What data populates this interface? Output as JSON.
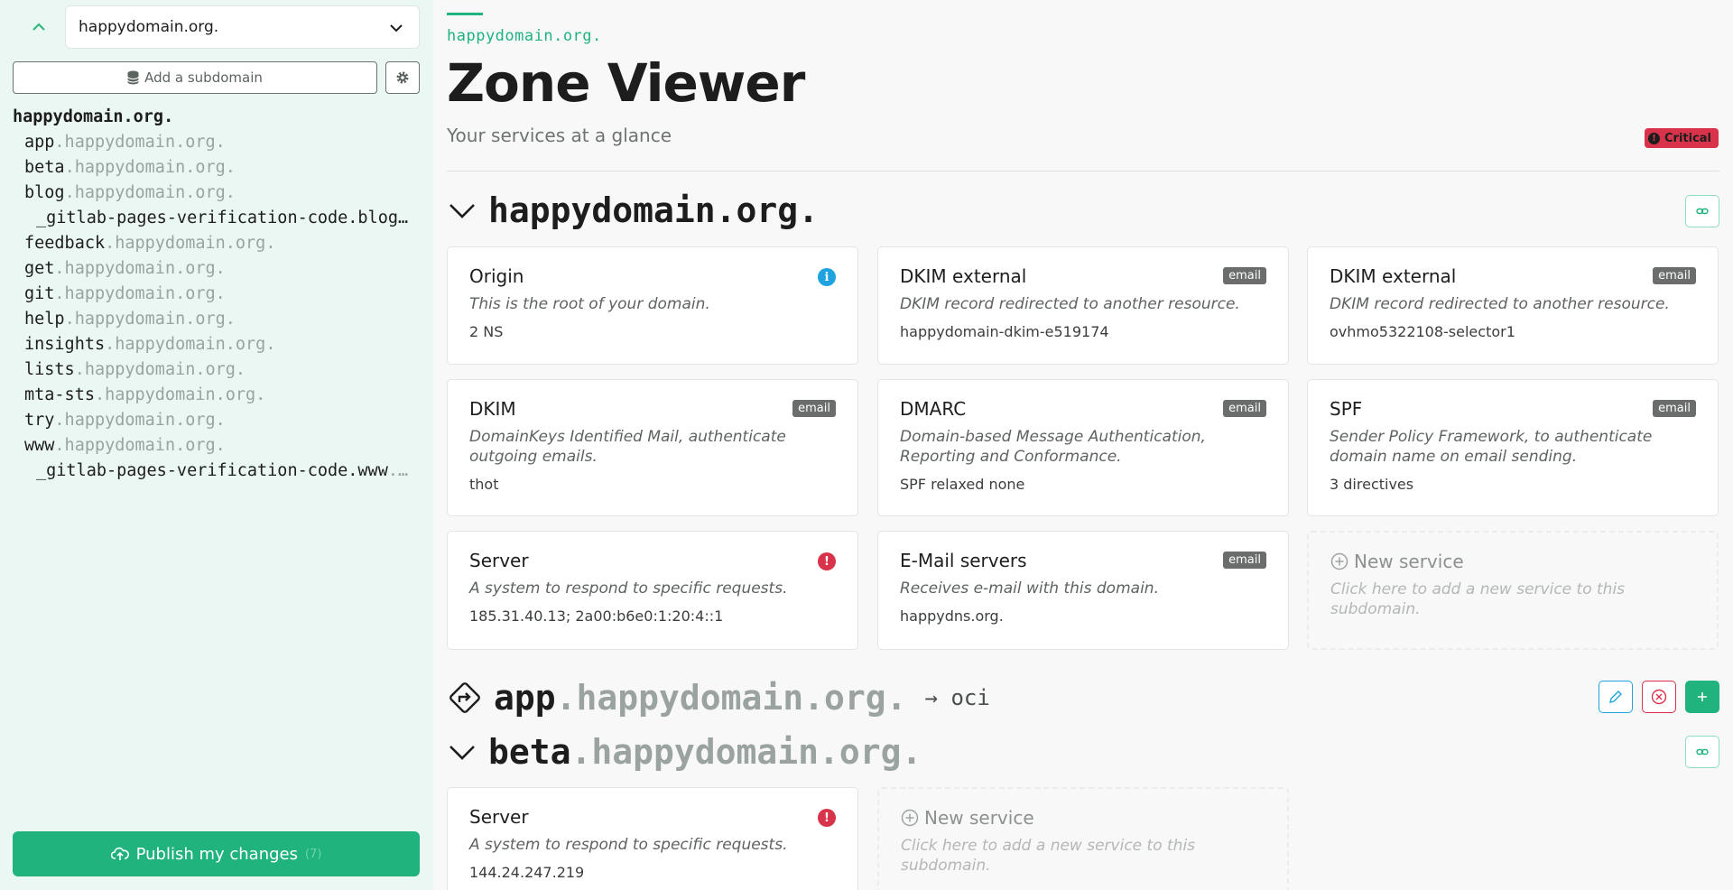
{
  "sidebar": {
    "domain_select": "happydomain.org.",
    "add_subdomain_label": "Add a subdomain",
    "tree": {
      "root": "happydomain.org.",
      "items": [
        {
          "name": "app",
          "suffix": ".happydomain.org.",
          "deep": false
        },
        {
          "name": "beta",
          "suffix": ".happydomain.org.",
          "deep": false
        },
        {
          "name": "blog",
          "suffix": ".happydomain.org.",
          "deep": false
        },
        {
          "name": "_gitlab-pages-verification-code.blog…",
          "suffix": "",
          "deep": true
        },
        {
          "name": "feedback",
          "suffix": ".happydomain.org.",
          "deep": false
        },
        {
          "name": "get",
          "suffix": ".happydomain.org.",
          "deep": false
        },
        {
          "name": "git",
          "suffix": ".happydomain.org.",
          "deep": false
        },
        {
          "name": "help",
          "suffix": ".happydomain.org.",
          "deep": false
        },
        {
          "name": "insights",
          "suffix": ".happydomain.org.",
          "deep": false
        },
        {
          "name": "lists",
          "suffix": ".happydomain.org.",
          "deep": false
        },
        {
          "name": "mta-sts",
          "suffix": ".happydomain.org.",
          "deep": false
        },
        {
          "name": "try",
          "suffix": ".happydomain.org.",
          "deep": false
        },
        {
          "name": "www",
          "suffix": ".happydomain.org.",
          "deep": false
        },
        {
          "name": "_gitlab-pages-verification-code.www",
          "suffix": ".…",
          "deep": true
        }
      ]
    },
    "publish_label": "Publish my changes",
    "publish_count": "(7)"
  },
  "main": {
    "breadcrumb": "happydomain.org.",
    "title": "Zone Viewer",
    "subtitle": "Your services at a glance",
    "critical_label": "Critical",
    "zones": {
      "root": {
        "name": "happydomain.org.",
        "cards": [
          {
            "title": "Origin",
            "desc": "This is the root of your domain.",
            "value": "2 NS"
          },
          {
            "title": "DKIM external",
            "badge": "email",
            "desc": "DKIM record redirected to another resource.",
            "value": "happydomain-dkim-e519174"
          },
          {
            "title": "DKIM external",
            "badge": "email",
            "desc": "DKIM record redirected to another resource.",
            "value": "ovhmo5322108-selector1"
          },
          {
            "title": "DKIM",
            "badge": "email",
            "desc": "DomainKeys Identified Mail, authenticate outgoing emails.",
            "value": "thot"
          },
          {
            "title": "DMARC",
            "badge": "email",
            "desc": "Domain-based Message Authentication, Reporting and Conformance.",
            "value": "SPF relaxed none"
          },
          {
            "title": "SPF",
            "badge": "email",
            "desc": "Sender Policy Framework, to authenticate domain name on email sending.",
            "value": "3 directives"
          },
          {
            "title": "Server",
            "desc": "A system to respond to specific requests.",
            "value": "185.31.40.13; 2a00:b6e0:1:20:4::1"
          },
          {
            "title": "E-Mail servers",
            "badge": "email",
            "desc": "Receives e-mail with this domain.",
            "value": "happydns.org."
          }
        ],
        "new_service": {
          "title": "New service",
          "desc": "Click here to add a new service to this subdomain."
        }
      },
      "app": {
        "name": "app",
        "suffix": ".happydomain.org.",
        "target": "oci"
      },
      "beta": {
        "name": "beta",
        "suffix": ".happydomain.org.",
        "cards": [
          {
            "title": "Server",
            "desc": "A system to respond to specific requests.",
            "value": "144.24.247.219"
          }
        ],
        "new_service": {
          "title": "New service",
          "desc": "Click here to add a new service to this subdomain."
        }
      }
    }
  },
  "colors": {
    "accent": "#20b37e",
    "danger": "#d8334a",
    "info": "#1fa3e0",
    "badge": "#6a6d6c"
  }
}
